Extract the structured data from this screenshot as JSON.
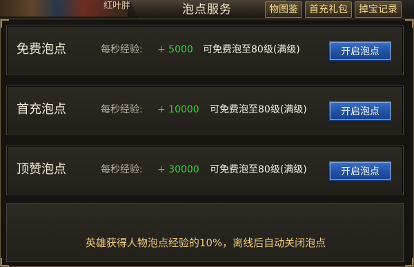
{
  "header": {
    "title": "泡点服务",
    "left_label": "红叶胖",
    "tabs": [
      "物图鉴",
      "首充礼包",
      "掉宝记录"
    ]
  },
  "rows": [
    {
      "title": "免费泡点",
      "exp_label": "每秒经验:",
      "exp_value": "+ 5000",
      "desc": "可免费泡至80级(满级)",
      "button": "开启泡点"
    },
    {
      "title": "首充泡点",
      "exp_label": "每秒经验:",
      "exp_value": "+ 10000",
      "desc": "可免费泡至80级(满级)",
      "button": "开启泡点"
    },
    {
      "title": "顶赞泡点",
      "exp_label": "每秒经验:",
      "exp_value": "+ 30000",
      "desc": "可免费泡至80级(满级)",
      "button": "开启泡点"
    }
  ],
  "footer": {
    "text": "英雄获得人物泡点经验的10%，离线后自动关闭泡点"
  }
}
